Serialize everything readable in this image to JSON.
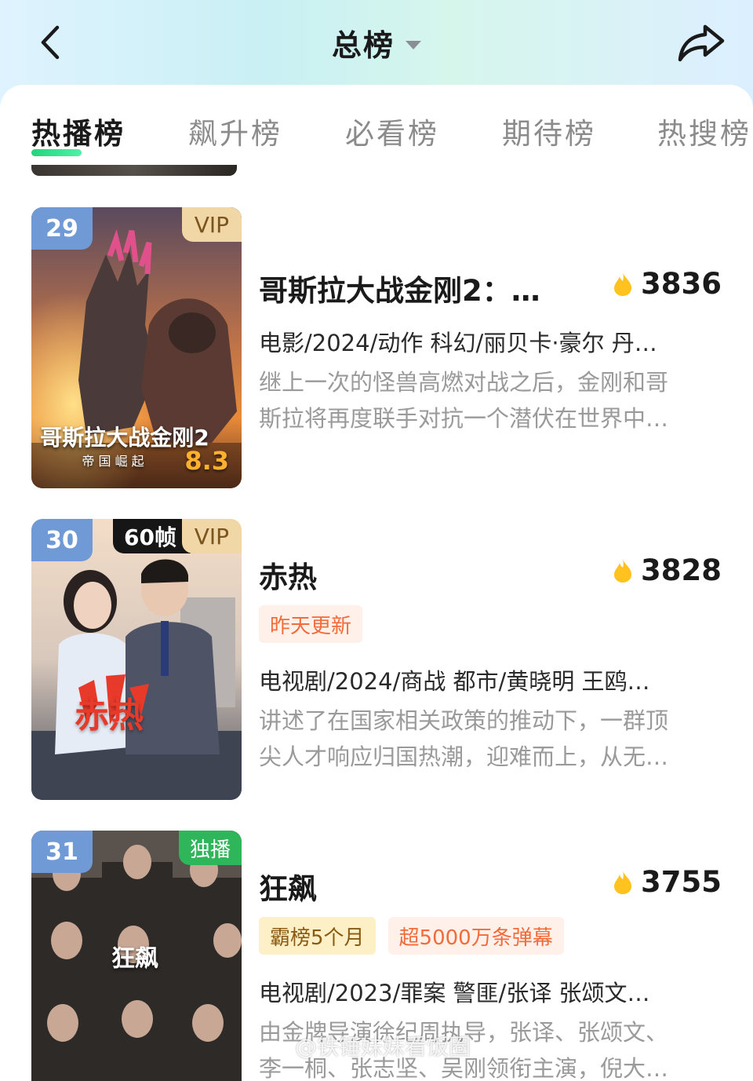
{
  "header": {
    "title": "总榜"
  },
  "tabs": [
    {
      "label": "热播榜",
      "active": true
    },
    {
      "label": "飙升榜",
      "active": false
    },
    {
      "label": "必看榜",
      "active": false
    },
    {
      "label": "期待榜",
      "active": false
    },
    {
      "label": "热搜榜",
      "active": false
    }
  ],
  "items": [
    {
      "rank": "29",
      "badges": [
        "VIP"
      ],
      "poster_title": "哥斯拉大战金刚2",
      "poster_subtitle": "帝 国 崛 起",
      "poster_score": "8.3",
      "title": "哥斯拉大战金刚2：…",
      "heat": "3836",
      "meta": "电影/2024/动作 科幻/丽贝卡·豪尔 丹…",
      "desc": [
        "继上一次的怪兽高燃对战之后，金刚和哥",
        "斯拉将再度联手对抗一个潜伏在世界中…"
      ]
    },
    {
      "rank": "30",
      "badges": [
        "60帧",
        "VIP"
      ],
      "poster_title": "赤热",
      "title": "赤热",
      "heat": "3828",
      "tags": [
        "昨天更新"
      ],
      "meta": "电视剧/2024/商战 都市/黄晓明 王鸥…",
      "desc": [
        "讲述了在国家相关政策的推动下，一群顶",
        "尖人才响应归国热潮，迎难而上，从无…"
      ]
    },
    {
      "rank": "31",
      "badges": [
        "独播"
      ],
      "poster_title": "狂飙",
      "title": "狂飙",
      "heat": "3755",
      "tags": [
        "霸榜5个月",
        "超5000万条弹幕"
      ],
      "meta": "电视剧/2023/罪案 警匪/张译 张颂文…",
      "desc": [
        "由金牌导演徐纪周执导，张译、张颂文、",
        "李一桐、张志坚、吴刚领衔主演，倪大…"
      ]
    }
  ],
  "watermark": "@铁锤妹妹看饭圈",
  "colors": {
    "accent_green": "#23d47c",
    "rank_blue": "#6f9ad6",
    "vip_gold": "#f1d7a6",
    "heat_flame": "#ffc21f",
    "tag_orange": "#f26b3a"
  }
}
